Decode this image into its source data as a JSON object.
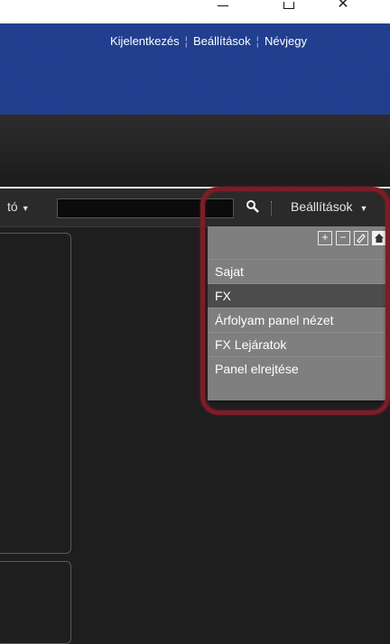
{
  "window": {
    "minimize_glyph": "",
    "maximize_glyph": "",
    "close_glyph": "✕"
  },
  "header": {
    "links": [
      "Kijelentkezés",
      "Beállítások",
      "Névjegy"
    ]
  },
  "toolbar": {
    "dropdown_label": "tó",
    "search_value": "",
    "settings_label": "Beállítások"
  },
  "menu": {
    "icons": [
      "plus-icon",
      "minus-icon",
      "eraser-icon",
      "home-icon"
    ],
    "items": [
      {
        "label": "Sajat",
        "active": false
      },
      {
        "label": "FX",
        "active": true
      },
      {
        "label": "Árfolyam panel nézet",
        "active": false
      },
      {
        "label": "FX Lejáratok",
        "active": false
      },
      {
        "label": "Panel elrejtése",
        "active": false
      }
    ]
  },
  "colors": {
    "header_blue": "#1f3d8f",
    "highlight": "#7b1d28",
    "menu_bg": "#7f7f7f",
    "menu_active": "#4c4c4c"
  }
}
